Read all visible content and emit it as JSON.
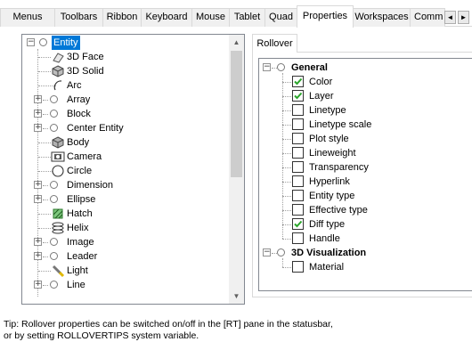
{
  "tabs": [
    {
      "label": "Menus"
    },
    {
      "label": "Toolbars"
    },
    {
      "label": "Ribbon"
    },
    {
      "label": "Keyboard"
    },
    {
      "label": "Mouse"
    },
    {
      "label": "Tablet"
    },
    {
      "label": "Quad"
    },
    {
      "label": "Properties"
    },
    {
      "label": "Workspaces"
    },
    {
      "label": "Comm"
    }
  ],
  "active_tab": "Properties",
  "tab_scroll": {
    "left": "◄",
    "right": "►"
  },
  "left_tree": {
    "root": {
      "label": "Entity",
      "selected": true,
      "expanded": true
    },
    "items": [
      {
        "label": "3D Face",
        "icon": "3d-face-icon",
        "expandable": false
      },
      {
        "label": "3D Solid",
        "icon": "3d-solid-icon",
        "expandable": false
      },
      {
        "label": "Arc",
        "icon": "arc-icon",
        "expandable": false
      },
      {
        "label": "Array",
        "icon": "circle-icon",
        "expandable": true
      },
      {
        "label": "Block",
        "icon": "circle-icon",
        "expandable": true
      },
      {
        "label": "Center Entity",
        "icon": "circle-icon",
        "expandable": true
      },
      {
        "label": "Body",
        "icon": "body-icon",
        "expandable": false
      },
      {
        "label": "Camera",
        "icon": "camera-icon",
        "expandable": false
      },
      {
        "label": "Circle",
        "icon": "circle-shape-icon",
        "expandable": false
      },
      {
        "label": "Dimension",
        "icon": "circle-icon",
        "expandable": true
      },
      {
        "label": "Ellipse",
        "icon": "ellipse-icon",
        "expandable": true
      },
      {
        "label": "Hatch",
        "icon": "hatch-icon",
        "expandable": false
      },
      {
        "label": "Helix",
        "icon": "helix-icon",
        "expandable": false
      },
      {
        "label": "Image",
        "icon": "circle-icon",
        "expandable": true
      },
      {
        "label": "Leader",
        "icon": "circle-icon",
        "expandable": true
      },
      {
        "label": "Light",
        "icon": "light-icon",
        "expandable": false
      },
      {
        "label": "Line",
        "icon": "circle-icon",
        "expandable": true
      }
    ]
  },
  "right_panel": {
    "subtab": "Rollover",
    "groups": [
      {
        "label": "General",
        "items": [
          {
            "label": "Color",
            "checked": true
          },
          {
            "label": "Layer",
            "checked": true
          },
          {
            "label": "Linetype",
            "checked": false
          },
          {
            "label": "Linetype scale",
            "checked": false
          },
          {
            "label": "Plot style",
            "checked": false
          },
          {
            "label": "Lineweight",
            "checked": false
          },
          {
            "label": "Transparency",
            "checked": false
          },
          {
            "label": "Hyperlink",
            "checked": false
          },
          {
            "label": "Entity type",
            "checked": false
          },
          {
            "label": "Effective type",
            "checked": false
          },
          {
            "label": "Diff type",
            "checked": true
          },
          {
            "label": "Handle",
            "checked": false
          }
        ]
      },
      {
        "label": "3D Visualization",
        "items": [
          {
            "label": "Material",
            "checked": false
          }
        ]
      }
    ]
  },
  "tip": {
    "line1": "Tip: Rollover properties can be switched on/off in the [RT] pane in the statusbar,",
    "line2": "or by setting ROLLOVERTIPS system variable."
  },
  "colors": {
    "selection": "#0078d7",
    "check": "#2aa52a",
    "border": "#828790",
    "tab_border": "#d9d9d9"
  }
}
